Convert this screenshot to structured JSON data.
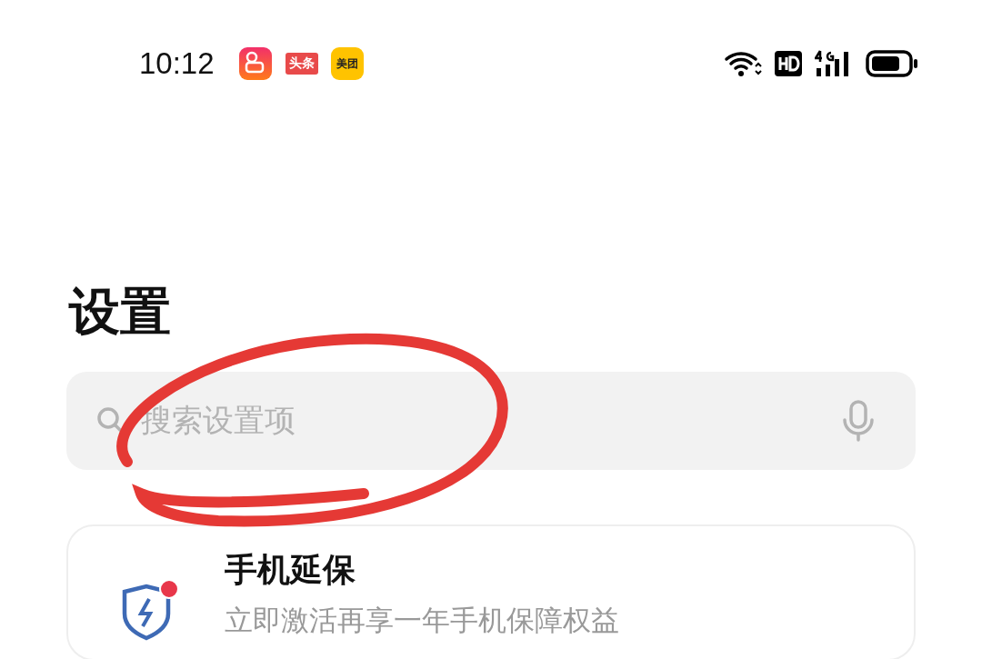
{
  "status_bar": {
    "time": "10:12",
    "notifications": [
      {
        "kind": "camera"
      },
      {
        "kind": "tag",
        "label": "头条"
      },
      {
        "kind": "rounded",
        "label": "美团"
      }
    ]
  },
  "title": "设置",
  "search": {
    "placeholder": "搜索设置项"
  },
  "annotation": {
    "kind": "ellipse"
  },
  "cards": [
    {
      "title": "手机延保",
      "subtitle": "立即激活再享一年手机保障权益",
      "badge": true
    }
  ]
}
